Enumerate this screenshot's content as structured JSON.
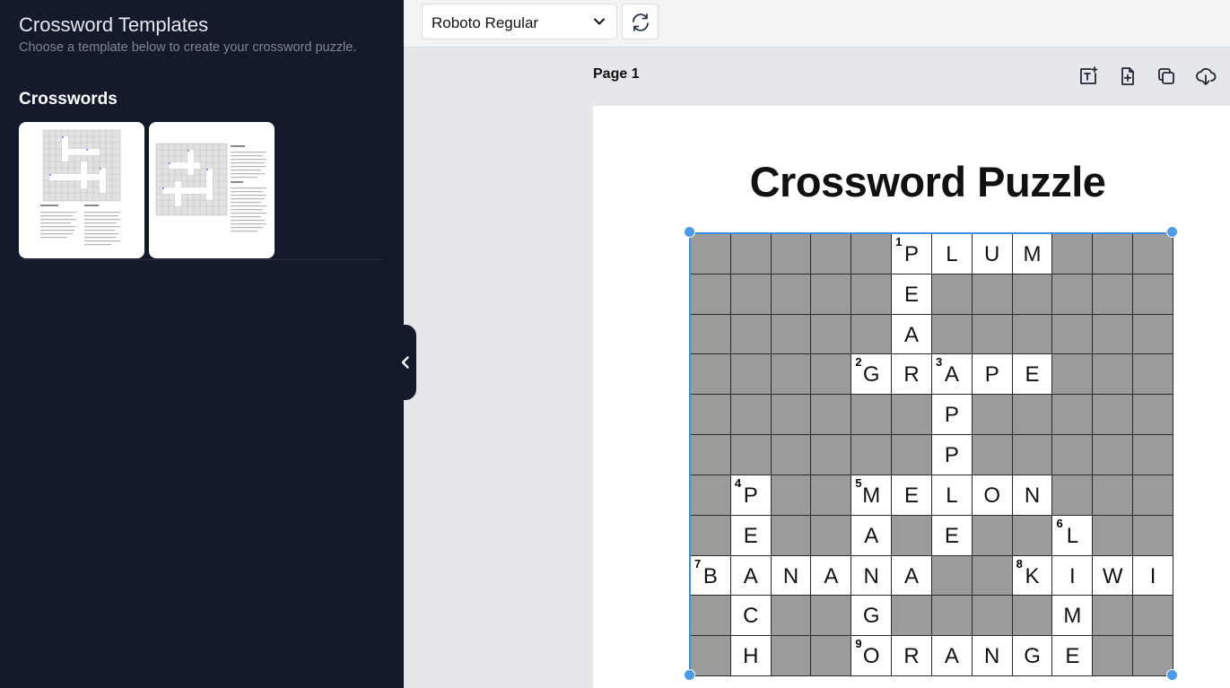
{
  "sidebar": {
    "title": "Crossword Templates",
    "subtitle": "Choose a template below to create your crossword puzzle.",
    "section": "Crosswords",
    "templates": [
      {
        "name": "crossword-template-1"
      },
      {
        "name": "crossword-template-2"
      }
    ]
  },
  "toolbar": {
    "font": "Roboto Regular",
    "refresh_icon": "refresh-icon",
    "dropdown_icon": "chevron-down-icon"
  },
  "page": {
    "label": "Page 1",
    "tools": [
      "add-text-icon",
      "add-page-icon",
      "duplicate-icon",
      "download-icon"
    ]
  },
  "puzzle": {
    "title": "Crossword Puzzle",
    "grid": [
      ".....PLUM...",
      ".....E......",
      ".....A......",
      "....GRAPE...",
      "......P.....",
      "......P.....",
      ".P..MELON...",
      ".E..A.E..L..",
      "BANANA..KIWI",
      ".C..G....M..",
      ".H..ORANGE.."
    ],
    "numbers": [
      {
        "r": 0,
        "c": 5,
        "n": "1"
      },
      {
        "r": 3,
        "c": 4,
        "n": "2"
      },
      {
        "r": 3,
        "c": 6,
        "n": "3"
      },
      {
        "r": 6,
        "c": 1,
        "n": "4"
      },
      {
        "r": 6,
        "c": 4,
        "n": "5"
      },
      {
        "r": 7,
        "c": 9,
        "n": "6"
      },
      {
        "r": 8,
        "c": 0,
        "n": "7"
      },
      {
        "r": 8,
        "c": 8,
        "n": "8"
      },
      {
        "r": 10,
        "c": 4,
        "n": "9"
      }
    ]
  },
  "colors": {
    "sidebar_bg": "#131a2b",
    "selection": "#3b8ee6",
    "filled_cell": "#9b9b9b"
  }
}
